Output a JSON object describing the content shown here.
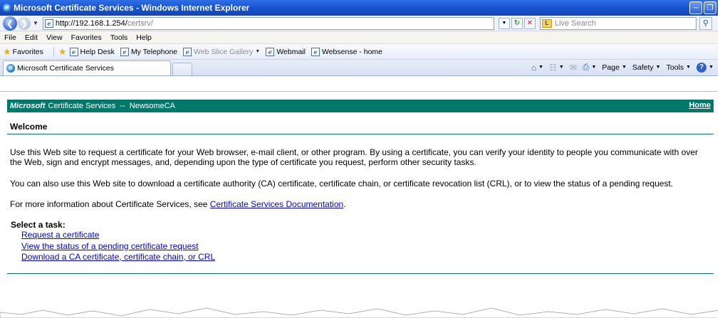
{
  "window": {
    "title": "Microsoft Certificate Services - Windows Internet Explorer"
  },
  "address_bar": {
    "url_host": "http://192.168.1.254/",
    "url_path": "certsrv/"
  },
  "search": {
    "placeholder": "Live Search"
  },
  "menu": [
    "File",
    "Edit",
    "View",
    "Favorites",
    "Tools",
    "Help"
  ],
  "favorites_bar": {
    "label": "Favorites",
    "items": [
      "Help Desk",
      "My Telephone",
      "Web Slice Gallery",
      "Webmail",
      "Websense - home"
    ]
  },
  "tab": {
    "title": "Microsoft Certificate Services"
  },
  "command_bar": {
    "page": "Page",
    "safety": "Safety",
    "tools": "Tools"
  },
  "page": {
    "header_brand": "Microsoft",
    "header_text": "Certificate Services  --  NewsomeCA",
    "home_link": "Home",
    "heading": "Welcome",
    "para1": "Use this Web site to request a certificate for your Web browser, e-mail client, or other program. By using a certificate, you can verify your identity to people you communicate with over the Web, sign and encrypt messages, and, depending upon the type of certificate you request, perform other security tasks.",
    "para2": "You can also use this Web site to download a certificate authority (CA) certificate, certificate chain, or certificate revocation list (CRL), or to view the status of a pending request.",
    "para3_prefix": "For more information about Certificate Services, see ",
    "para3_link": "Certificate Services Documentation",
    "para3_suffix": ".",
    "task_title": "Select a task:",
    "tasks": [
      "Request a certificate",
      "View the status of a pending certificate request",
      "Download a CA certificate, certificate chain, or CRL"
    ]
  },
  "colors": {
    "header_bg": "#00796b",
    "link": "#0000ee",
    "title_bar": "#1b55d0"
  }
}
